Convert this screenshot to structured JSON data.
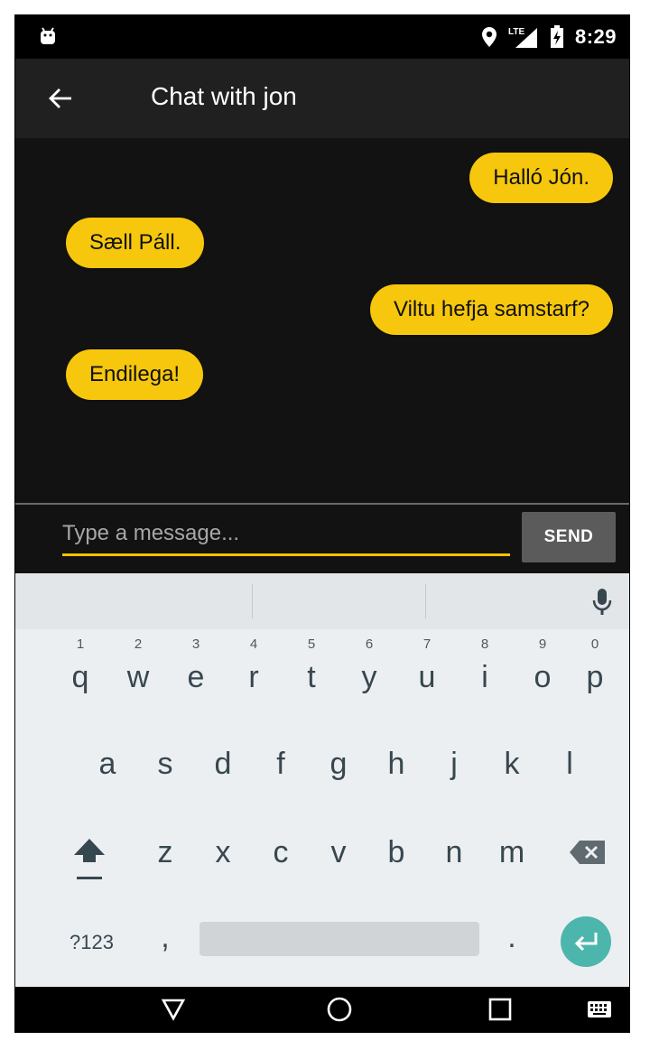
{
  "status_bar": {
    "time": "8:29",
    "network": "LTE"
  },
  "app_bar": {
    "title": "Chat with jon",
    "back_icon": "arrow-back-icon"
  },
  "messages": [
    {
      "text": "Halló Jón.",
      "side": "me"
    },
    {
      "text": "Sæll Páll.",
      "side": "them"
    },
    {
      "text": "Viltu hefja samstarf?",
      "side": "me"
    },
    {
      "text": "Endilega!",
      "side": "them"
    }
  ],
  "composer": {
    "placeholder": "Type a message...",
    "send_label": "SEND"
  },
  "keyboard": {
    "row1": [
      "q",
      "w",
      "e",
      "r",
      "t",
      "y",
      "u",
      "i",
      "o",
      "p"
    ],
    "row1_hints": [
      "1",
      "2",
      "3",
      "4",
      "5",
      "6",
      "7",
      "8",
      "9",
      "0"
    ],
    "row2": [
      "a",
      "s",
      "d",
      "f",
      "g",
      "h",
      "j",
      "k",
      "l"
    ],
    "row3": [
      "z",
      "x",
      "c",
      "v",
      "b",
      "n",
      "m"
    ],
    "symbols_label": "?123",
    "comma": ",",
    "period": "."
  },
  "colors": {
    "bubble": "#f6c70c",
    "accent": "#f2c200",
    "enter": "#4db6ac"
  }
}
